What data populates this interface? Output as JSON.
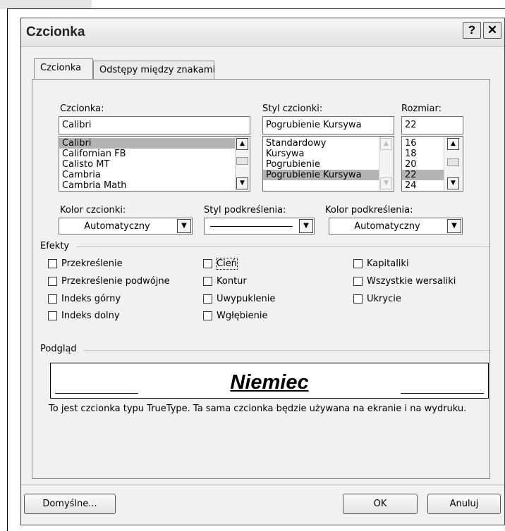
{
  "dialog": {
    "title": "Czcionka",
    "help_button": "?",
    "close_button": "✕"
  },
  "tabs": [
    {
      "label": "Czcionka",
      "active": true
    },
    {
      "label": "Odstępy między znakami",
      "active": false
    }
  ],
  "font": {
    "label": "Czcionka:",
    "value": "Calibri",
    "items": [
      "Calibri",
      "Californian FB",
      "Calisto MT",
      "Cambria",
      "Cambria Math"
    ],
    "selected": "Calibri"
  },
  "style": {
    "label": "Styl czcionki:",
    "value": "Pogrubienie Kursywa",
    "items": [
      "Standardowy",
      "Kursywa",
      "Pogrubienie",
      "Pogrubienie Kursywa"
    ],
    "selected": "Pogrubienie Kursywa"
  },
  "size": {
    "label": "Rozmiar:",
    "value": "22",
    "items": [
      "16",
      "18",
      "20",
      "22",
      "24"
    ],
    "selected": "22"
  },
  "font_color": {
    "label": "Kolor czcionki:",
    "value": "Automatyczny"
  },
  "underline_style": {
    "label": "Styl podkreślenia:",
    "value": "(line)"
  },
  "underline_color": {
    "label": "Kolor podkreślenia:",
    "value": "Automatyczny"
  },
  "effects": {
    "heading": "Efekty",
    "items": [
      {
        "label": "Przekreślenie",
        "checked": false
      },
      {
        "label": "Przekreślenie podwójne",
        "checked": false
      },
      {
        "label": "Indeks górny",
        "checked": false
      },
      {
        "label": "Indeks dolny",
        "checked": false
      },
      {
        "label": "Cień",
        "checked": false,
        "focused": true
      },
      {
        "label": "Kontur",
        "checked": false
      },
      {
        "label": "Uwypuklenie",
        "checked": false
      },
      {
        "label": "Wgłębienie",
        "checked": false
      },
      {
        "label": "Kapitaliki",
        "checked": false
      },
      {
        "label": "Wszystkie wersaliki",
        "checked": false
      },
      {
        "label": "Ukrycie",
        "checked": false
      }
    ]
  },
  "preview": {
    "heading": "Podgląd",
    "sample": "Niemiec",
    "note": "To jest czcionka typu TrueType. Ta sama czcionka będzie używana na ekranie i na wydruku."
  },
  "buttons": {
    "default": "Domyślne...",
    "ok": "OK",
    "cancel": "Anuluj"
  },
  "colors": {
    "dialog_bg": "#f1f1f1",
    "selection": "#b4b4b4"
  }
}
